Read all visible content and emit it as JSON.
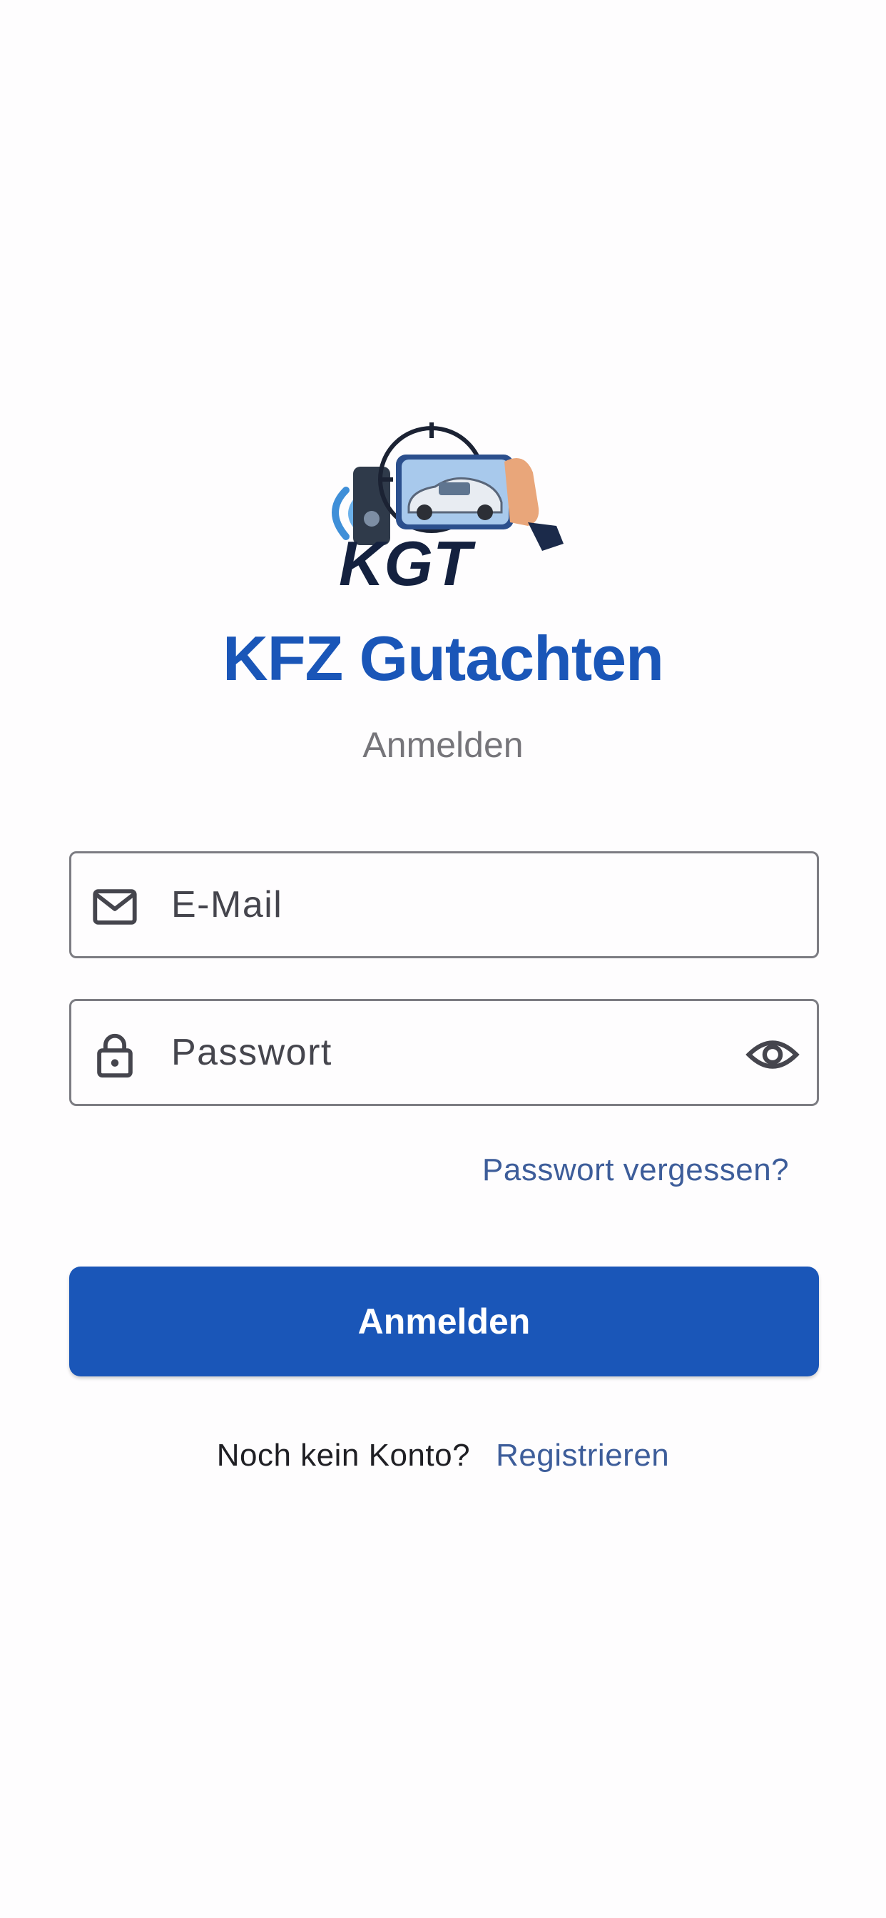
{
  "app": {
    "title": "KFZ Gutachten",
    "subtitle": "Anmelden",
    "logo_text": "KGT"
  },
  "form": {
    "email": {
      "placeholder": "E-Mail",
      "value": "",
      "icon": "mail-icon"
    },
    "password": {
      "placeholder": "Passwort",
      "value": "",
      "icon": "lock-icon",
      "toggle_icon": "eye-icon"
    },
    "forgot_password_label": "Passwort vergessen?",
    "submit_label": "Anmelden"
  },
  "footer": {
    "question": "Noch kein Konto?",
    "register_label": "Registrieren"
  },
  "colors": {
    "primary": "#1a56b8",
    "link": "#3d5d9a",
    "background": "#fefdfe",
    "border": "#7c7c82"
  }
}
